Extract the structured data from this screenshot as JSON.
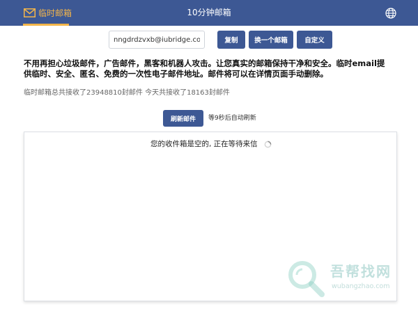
{
  "navbar": {
    "brand_label": "临时邮箱",
    "center_title": "10分钟邮箱",
    "language_icon": "globe-icon",
    "accent_color": "#f3b54a",
    "bg_color": "#3d5894"
  },
  "toolbar": {
    "email_value": "nngdrdzvxb@iubridge.com",
    "copy_label": "复制",
    "change_label": "换一个邮箱",
    "custom_label": "自定义"
  },
  "intro_text": "不用再担心垃圾邮件，广告邮件，黑客和机器人攻击。让您真实的邮箱保持干净和安全。临时email提供临时、安全、匿名、免费的一次性电子邮件地址。邮件将可以在详情页面手动删除。",
  "stats_text": "临时邮箱总共接收了23948810封邮件 今天共接收了18163封邮件",
  "refresh": {
    "button_label": "刷新邮件",
    "countdown_text": "等9秒后自动刷新"
  },
  "inbox": {
    "empty_message": "您的收件箱是空的, 正在等待来信"
  },
  "watermark": {
    "title": "吾帮找网",
    "subtitle": "wubangzhao.com"
  }
}
